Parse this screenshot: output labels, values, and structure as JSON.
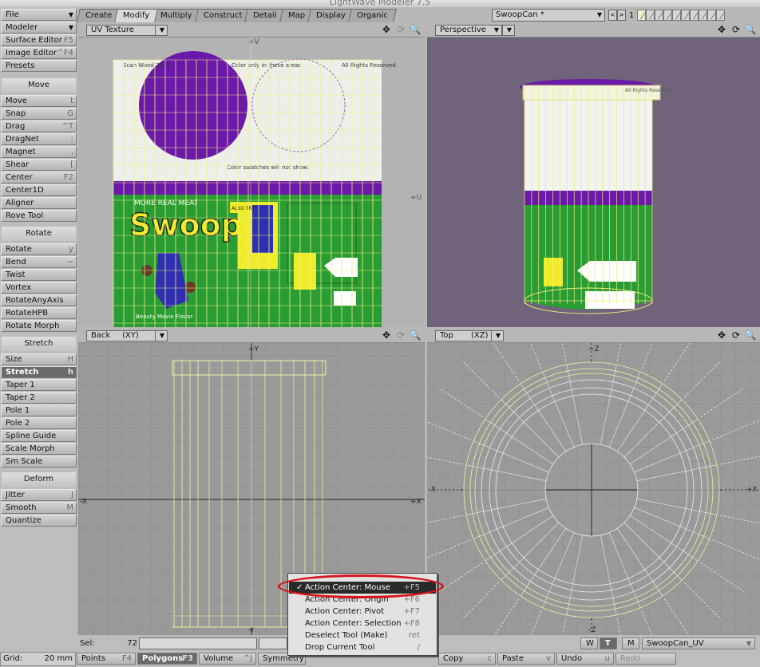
{
  "window": {
    "title": "LightWave Modeler 7.5"
  },
  "sidebar": {
    "top": [
      {
        "label": "File",
        "dd": true
      },
      {
        "label": "Modeler",
        "dd": true
      },
      {
        "label": "Surface Editor",
        "sc": "F5"
      },
      {
        "label": "Image Editor",
        "sc": "^F4"
      },
      {
        "label": "Presets",
        "sc": ""
      }
    ],
    "groups": [
      {
        "header": "Move",
        "items": [
          {
            "label": "Move",
            "sc": "t"
          },
          {
            "label": "Snap",
            "sc": "G"
          },
          {
            "label": "Drag",
            "sc": "^T"
          },
          {
            "label": "DragNet",
            "sc": ";"
          },
          {
            "label": "Magnet",
            "sc": ","
          },
          {
            "label": "Shear",
            "sc": "["
          },
          {
            "label": "Center",
            "sc": "F2"
          },
          {
            "label": "Center1D",
            "sc": ""
          },
          {
            "label": "Aligner",
            "sc": ""
          },
          {
            "label": "Rove Tool",
            "sc": ""
          }
        ]
      },
      {
        "header": "Rotate",
        "items": [
          {
            "label": "Rotate",
            "sc": "y"
          },
          {
            "label": "Bend",
            "sc": "~"
          },
          {
            "label": "Twist",
            "sc": ""
          },
          {
            "label": "Vortex",
            "sc": ""
          },
          {
            "label": "RotateAnyAxis",
            "sc": ""
          },
          {
            "label": "RotateHPB",
            "sc": ""
          },
          {
            "label": "Rotate Morph",
            "sc": ""
          }
        ]
      },
      {
        "header": "Stretch",
        "items": [
          {
            "label": "Size",
            "sc": "H"
          },
          {
            "label": "Stretch",
            "sc": "h",
            "selected": true
          },
          {
            "label": "Taper 1",
            "sc": ""
          },
          {
            "label": "Taper 2",
            "sc": ""
          },
          {
            "label": "Pole 1",
            "sc": ""
          },
          {
            "label": "Pole 2",
            "sc": ""
          },
          {
            "label": "Spline Guide",
            "sc": ""
          },
          {
            "label": "Scale Morph",
            "sc": ""
          },
          {
            "label": "Sm Scale",
            "sc": ""
          }
        ]
      },
      {
        "header": "Deform",
        "items": [
          {
            "label": "Jitter",
            "sc": "J"
          },
          {
            "label": "Smooth",
            "sc": "M"
          },
          {
            "label": "Quantize",
            "sc": ""
          }
        ]
      }
    ],
    "grid_label": "Grid:",
    "grid_value": "20 mm"
  },
  "tabs": [
    {
      "label": "Create"
    },
    {
      "label": "Modify",
      "active": true
    },
    {
      "label": "Multiply"
    },
    {
      "label": "Construct"
    },
    {
      "label": "Detail"
    },
    {
      "label": "Map"
    },
    {
      "label": "Display"
    },
    {
      "label": "Organic"
    }
  ],
  "object": {
    "name": "SwoopCan *"
  },
  "layers": {
    "current": "1",
    "prev": "<",
    "next": ">"
  },
  "viewports": {
    "uv": {
      "mode": "UV Texture",
      "axis_top": "+V",
      "axis_right": "+U",
      "label": {
        "brand": "Swoop",
        "tagline": "MORE REAL MEAT",
        "flavor": "Beauty Movie Flavor",
        "colorTop": "Color only in these areas",
        "colorBottom": "Color swatches will not show.",
        "rights": "All Rights Reserved",
        "scan": "Scan Wood 2003",
        "badge": "ALSO TRY"
      },
      "colors": {
        "purple": "#6b19a8",
        "green": "#2a9c34",
        "cream": "#eeefea",
        "yellow": "#f0ec2a"
      }
    },
    "perspective": {
      "mode": "Perspective",
      "rights": "All Rights Reserved",
      "bg": "#70647c"
    },
    "back": {
      "mode": "Back",
      "axes": "(XY)",
      "top": "+Y",
      "left": "-X",
      "right": "+X",
      "bottom": "-Y"
    },
    "top": {
      "mode": "Top",
      "axes": "(XZ)",
      "top": "+Z",
      "left": "-X",
      "right": "+X",
      "bottom": "-Z"
    }
  },
  "popup": {
    "items": [
      {
        "label": "Action Center: Mouse",
        "sc": "+F5",
        "checked": true
      },
      {
        "label": "Action Center: Origin",
        "sc": "+F6"
      },
      {
        "label": "Action Center: Pivot",
        "sc": "+F7"
      },
      {
        "label": "Action Center: Selection",
        "sc": "+F8"
      },
      {
        "label": "Deselect Tool (Make)",
        "sc": "ret"
      },
      {
        "label": "Drop Current Tool",
        "sc": "/"
      }
    ]
  },
  "bottom": {
    "sel_label": "Sel:",
    "sel_value": "72",
    "modes": [
      {
        "label": "Points",
        "sc": "F4"
      },
      {
        "label": "Polygons",
        "sc": "F3",
        "selected": true
      },
      {
        "label": "Volume",
        "sc": "^J"
      },
      {
        "label": "Symmetry",
        "sc": ""
      }
    ],
    "edit": [
      {
        "label": "Copy",
        "sc": "c"
      },
      {
        "label": "Paste",
        "sc": "v"
      },
      {
        "label": "Undo",
        "sc": "u"
      },
      {
        "label": "Redo",
        "sc": ""
      }
    ],
    "wtm": [
      "W",
      "T",
      "M"
    ],
    "uvmap": "SwoopCan_UV"
  }
}
